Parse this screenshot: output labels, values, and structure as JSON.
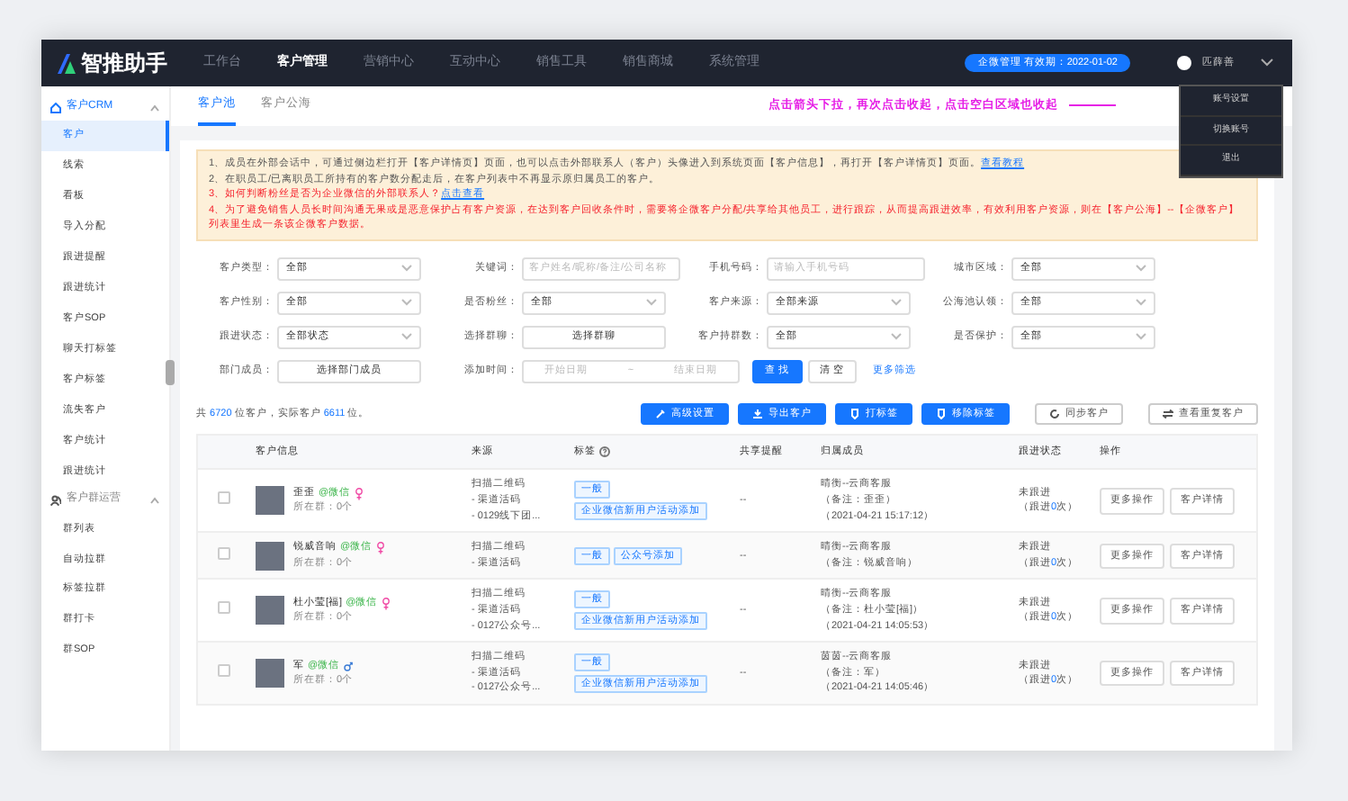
{
  "topbar": {
    "logo": "智推助手",
    "nav": [
      {
        "label": "工作台",
        "selected": false
      },
      {
        "label": "客户管理",
        "selected": true
      },
      {
        "label": "营销中心",
        "selected": false
      },
      {
        "label": "互动中心",
        "selected": false
      },
      {
        "label": "销售工具",
        "selected": false
      },
      {
        "label": "销售商城",
        "selected": false
      },
      {
        "label": "系统管理",
        "selected": false
      }
    ],
    "expiry_badge": "企微管理 有效期：2022-01-02",
    "user": "匹薛善",
    "menu_expanded": true,
    "menu": [
      "账号设置",
      "切换账号",
      "退出"
    ]
  },
  "annotation": "点击箭头下拉，再次点击收起，点击空白区域也收起",
  "sidebar": {
    "groups": [
      {
        "label": "客户CRM",
        "kind": "crm",
        "expanded": true,
        "items": [
          {
            "label": "客户",
            "selected": true
          },
          {
            "label": "线索",
            "selected": false
          },
          {
            "label": "看板",
            "selected": false
          },
          {
            "label": "导入分配",
            "selected": false
          },
          {
            "label": "跟进提醒",
            "selected": false
          },
          {
            "label": "跟进统计",
            "selected": false
          },
          {
            "label": "客户SOP",
            "selected": false
          },
          {
            "label": "聊天打标签",
            "selected": false
          },
          {
            "label": "客户标签",
            "selected": false
          },
          {
            "label": "流失客户",
            "selected": false
          },
          {
            "label": "客户统计",
            "selected": false
          },
          {
            "label": "跟进统计",
            "selected": false
          }
        ]
      },
      {
        "label": "客户群运营",
        "kind": "group",
        "expanded": true,
        "items": [
          {
            "label": "群列表",
            "selected": false
          },
          {
            "label": "自动拉群",
            "selected": false
          },
          {
            "label": "标签拉群",
            "selected": false
          },
          {
            "label": "群打卡",
            "selected": false
          },
          {
            "label": "群SOP",
            "selected": false
          }
        ]
      }
    ]
  },
  "tabs": [
    {
      "label": "客户池",
      "selected": true
    },
    {
      "label": "客户公海",
      "selected": false
    }
  ],
  "notices": [
    {
      "kind": "normal",
      "text": "1、成员在外部会话中，可通过侧边栏打开【客户详情页】页面，也可以点击外部联系人（客户）头像进入到系统页面【客户信息】，再打开【客户详情页】页面。",
      "link": "查看教程"
    },
    {
      "kind": "normal",
      "text": "2、在职员工/已离职员工所持有的客户数分配走后，在客户列表中不再显示原归属员工的客户。"
    },
    {
      "kind": "warning",
      "text": "3、如何判断粉丝是否为企业微信的外部联系人？",
      "link": "点击查看"
    },
    {
      "kind": "warning",
      "text": "4、为了避免销售人员长时间沟通无果或是恶意保护占有客户资源，在达到客户回收条件时，需要将企微客户分配/共享给其他员工，进行跟踪，从而提高跟进效率，有效利用客户资源，则在【客户公海】--【企微客户】列表里生成一条该企微客户数据。"
    }
  ],
  "filter_rows": [
    [
      {
        "label": "客户类型：",
        "kind": "select",
        "value": "全部"
      },
      {
        "label": "关键词：",
        "kind": "input",
        "placeholder": "客户姓名/昵称/备注/公司名称"
      },
      {
        "label": "手机号码：",
        "kind": "input",
        "placeholder": "请输入手机号码"
      },
      {
        "label": "城市区域：",
        "kind": "select",
        "value": "全部"
      }
    ],
    [
      {
        "label": "客户性别：",
        "kind": "select",
        "value": "全部"
      },
      {
        "label": "是否粉丝：",
        "kind": "select",
        "value": "全部"
      },
      {
        "label": "客户来源：",
        "kind": "select",
        "value": "全部来源"
      },
      {
        "label": "公海池认领：",
        "kind": "select",
        "value": "全部"
      }
    ],
    [
      {
        "label": "跟进状态：",
        "kind": "select",
        "value": "全部状态"
      },
      {
        "label": "选择群聊：",
        "kind": "picker",
        "value": "选择群聊"
      },
      {
        "label": "客户持群数：",
        "kind": "select",
        "value": "全部"
      },
      {
        "label": "是否保护：",
        "kind": "select",
        "value": "全部"
      }
    ],
    [
      {
        "label": "部门成员：",
        "kind": "picker",
        "value": "选择部门成员"
      },
      {
        "label": "添加时间：",
        "kind": "daterange",
        "start_placeholder": "开始日期",
        "separator": "~",
        "end_placeholder": "结束日期"
      }
    ]
  ],
  "filter_actions": [
    {
      "label": "查 找",
      "kind": "primary"
    },
    {
      "label": "清 空",
      "kind": "outline"
    },
    {
      "label": "更多筛选",
      "kind": "link"
    }
  ],
  "summary": [
    {
      "kind": "plain",
      "text": "共 "
    },
    {
      "kind": "number",
      "text": "6720"
    },
    {
      "kind": "plain",
      "text": " 位客户，实际客户 "
    },
    {
      "kind": "number",
      "text": "6611"
    },
    {
      "kind": "plain",
      "text": " 位。"
    }
  ],
  "toolbar": [
    {
      "label": "高级设置",
      "kind": "primary"
    },
    {
      "label": "导出客户",
      "kind": "primary"
    },
    {
      "label": "打标签",
      "kind": "primary"
    },
    {
      "label": "移除标签",
      "kind": "primary"
    },
    {
      "label": "同步客户",
      "kind": "outline"
    },
    {
      "label": "查看重复客户",
      "kind": "outline"
    }
  ],
  "table": {
    "columns": [
      {
        "label": "客户信息"
      },
      {
        "label": "来源"
      },
      {
        "label": "标签",
        "help": true
      },
      {
        "label": "共享提醒"
      },
      {
        "label": "归属成员"
      },
      {
        "label": "跟进状态"
      },
      {
        "label": "操作"
      }
    ],
    "rows": [
      {
        "checked": false,
        "name": "歪歪",
        "channel": "@微信",
        "male": false,
        "groups": "所在群：0个",
        "source": [
          "扫描二维码",
          "- 渠道活码",
          "- 0129线下团..."
        ],
        "tags": [
          "一般",
          "企业微信新用户活动添加"
        ],
        "share": "--",
        "member": [
          "晴衡--云商客服",
          "（备注：歪歪）",
          "（2021-04-21 15:17:12）"
        ],
        "status": "未跟进",
        "follow": {
          "prefix": "（跟进",
          "count": "0",
          "suffix": "次）"
        },
        "actions": [
          "更多操作",
          "客户详情"
        ]
      },
      {
        "checked": false,
        "name": "锐威音响",
        "channel": "@微信",
        "male": false,
        "groups": "所在群：0个",
        "source": [
          "扫描二维码",
          "- 渠道活码"
        ],
        "tags": [
          "一般",
          "公众号添加"
        ],
        "share": "--",
        "member": [
          "晴衡--云商客服",
          "（备注：锐威音响）"
        ],
        "status": "未跟进",
        "follow": {
          "prefix": "（跟进",
          "count": "0",
          "suffix": "次）"
        },
        "actions": [
          "更多操作",
          "客户详情"
        ]
      },
      {
        "checked": false,
        "name": "杜小莹[福]",
        "channel": "@微信",
        "male": false,
        "groups": "所在群：0个",
        "source": [
          "扫描二维码",
          "- 渠道活码",
          "- 0127公众号..."
        ],
        "tags": [
          "一般",
          "企业微信新用户活动添加"
        ],
        "share": "--",
        "member": [
          "晴衡--云商客服",
          "（备注：杜小莹[福]）",
          "（2021-04-21 14:05:53）"
        ],
        "status": "未跟进",
        "follow": {
          "prefix": "（跟进",
          "count": "0",
          "suffix": "次）"
        },
        "actions": [
          "更多操作",
          "客户详情"
        ]
      },
      {
        "checked": false,
        "name": "军",
        "channel": "@微信",
        "male": true,
        "groups": "所在群：0个",
        "source": [
          "扫描二维码",
          "- 渠道活码",
          "- 0127公众号..."
        ],
        "tags": [
          "一般",
          "企业微信新用户活动添加"
        ],
        "share": "--",
        "member": [
          "茵茵--云商客服",
          "（备注：军）",
          "（2021-04-21 14:05:46）"
        ],
        "status": "未跟进",
        "follow": {
          "prefix": "（跟进",
          "count": "0",
          "suffix": "次）"
        },
        "actions": [
          "更多操作",
          "客户详情"
        ]
      }
    ]
  }
}
